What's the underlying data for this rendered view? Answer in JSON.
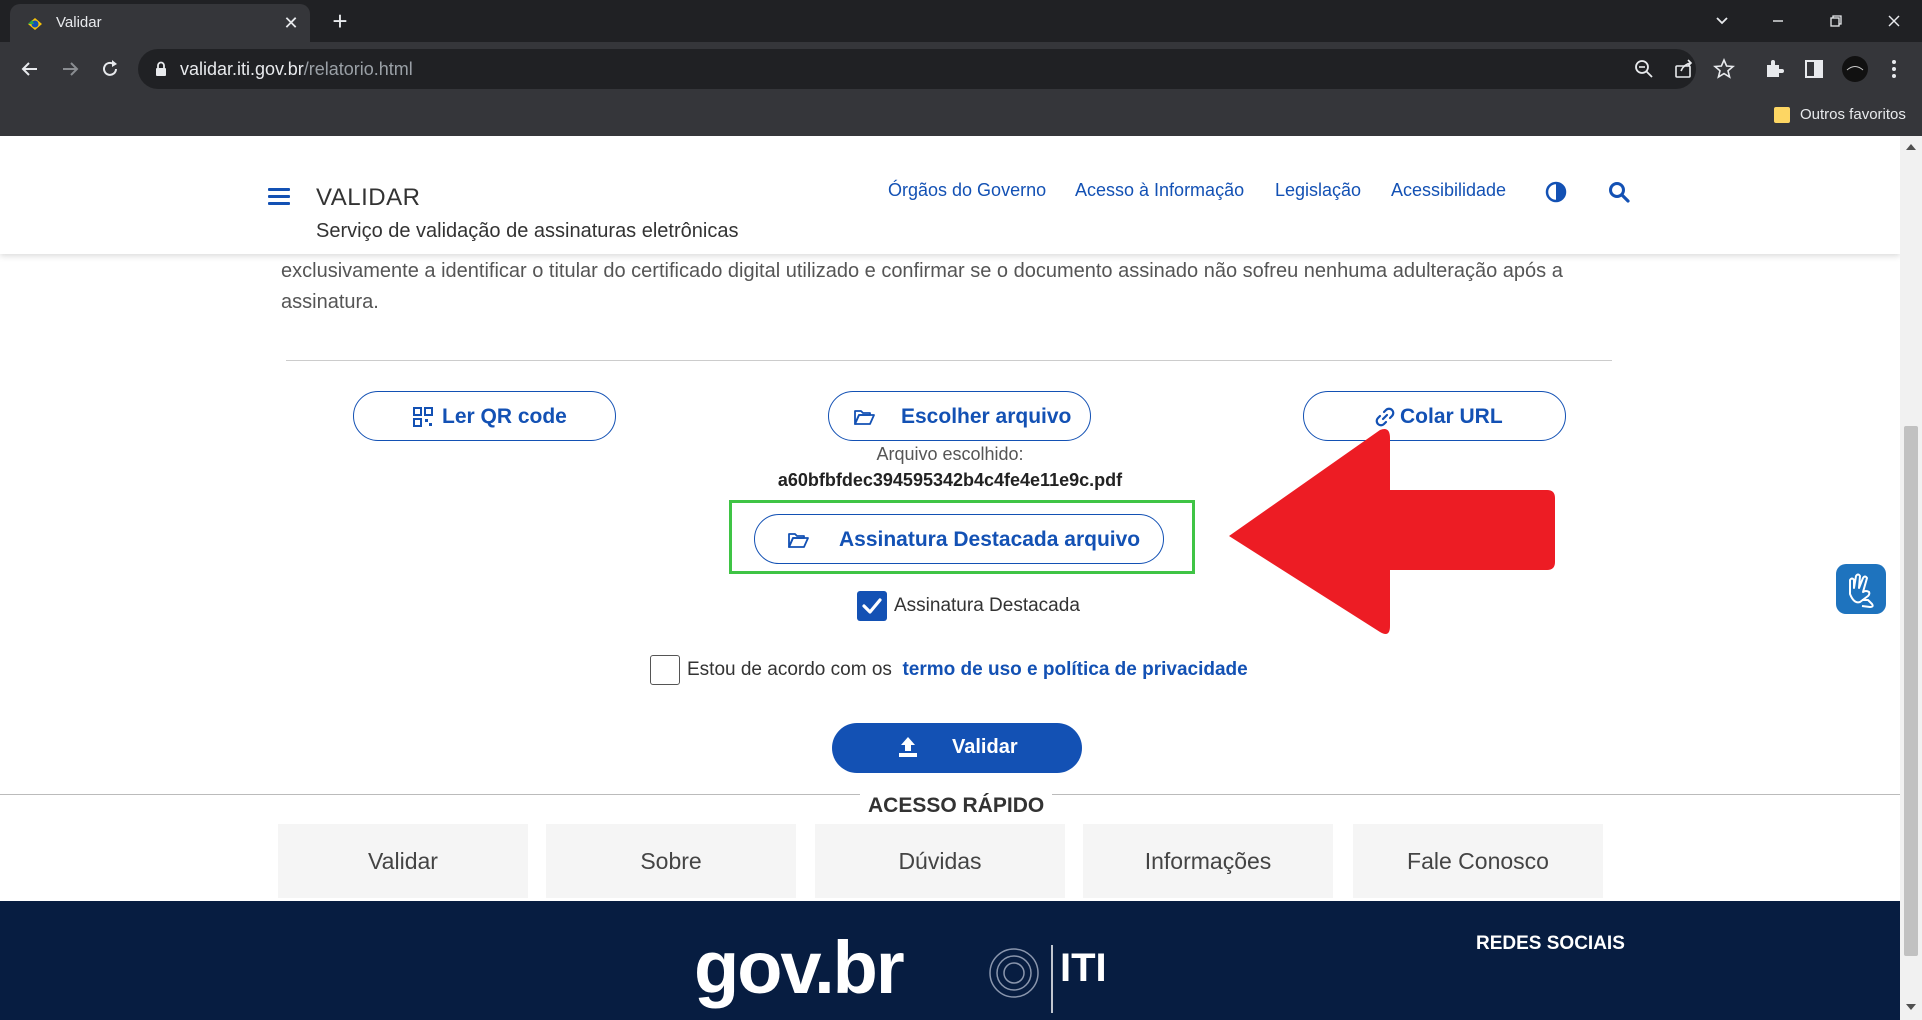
{
  "browser": {
    "tab_title": "Validar",
    "tab_close": "✕",
    "new_tab": "+",
    "url_domain": "validar.iti.gov.br",
    "url_path": "/relatorio.html",
    "bookmark_folder": "Outros favoritos"
  },
  "header": {
    "title": "VALIDAR",
    "subtitle": "Serviço de validação de assinaturas eletrônicas",
    "links": [
      "Órgãos do Governo",
      "Acesso à Informação",
      "Legislação",
      "Acessibilidade"
    ]
  },
  "intro": {
    "text": "exclusivamente a identificar o titular do certificado digital utilizado e confirmar se o documento assinado não sofreu nenhuma adulteração após a assinatura."
  },
  "actions": {
    "qr_label": "Ler QR code",
    "file_label": "Escolher arquivo",
    "url_label": "Colar URL",
    "chosen_label": "Arquivo escolhido:",
    "chosen_file": "a60bfbfdec394595342b4c4fe4e11e9c.pdf",
    "detached_label": "Assinatura Destacada arquivo",
    "detached_checkbox_label": "Assinatura Destacada",
    "detached_checked": true,
    "terms_prefix": "Estou de acordo com os",
    "terms_link": "termo de uso e política de privacidade",
    "terms_checked": false,
    "validate_label": "Validar"
  },
  "quick_access": {
    "title": "ACESSO RÁPIDO",
    "items": [
      "Validar",
      "Sobre",
      "Dúvidas",
      "Informações",
      "Fale Conosco"
    ]
  },
  "footer": {
    "gov_logo": "gov.br",
    "iti_logo": "ITI",
    "social_title": "REDES SOCIAIS"
  },
  "colors": {
    "brand_blue": "#1351b4",
    "footer_navy": "#071d41",
    "highlight_green": "#3fc445",
    "arrow_red": "#ed1c24"
  }
}
